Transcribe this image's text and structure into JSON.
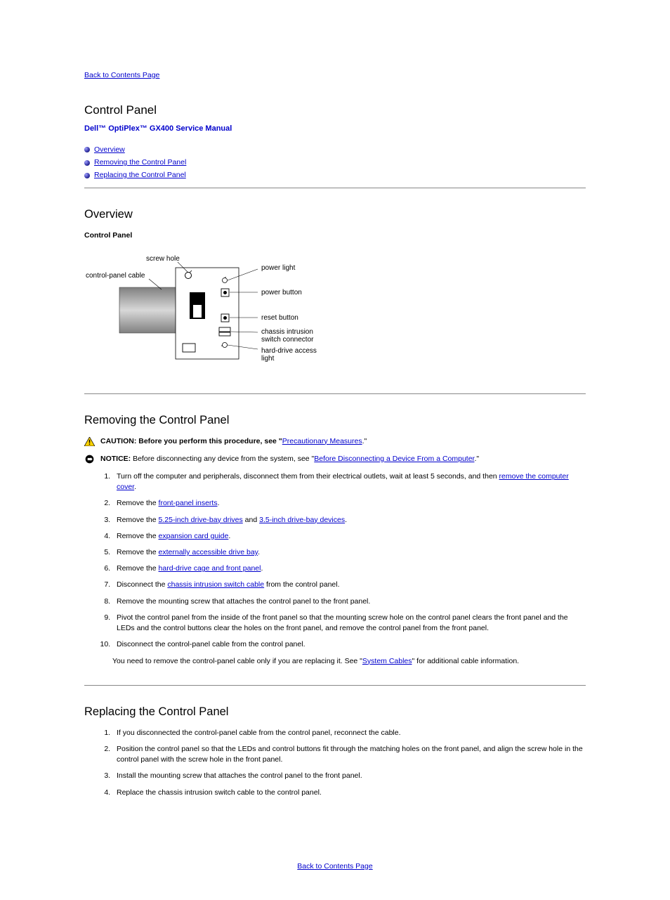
{
  "nav": {
    "back": "Back to Contents Page"
  },
  "title": {
    "main": "Control Panel",
    "manual": "Dell™ OptiPlex™ GX400 Service Manual"
  },
  "toc": {
    "overview": "Overview",
    "remove": "Removing the Control Panel",
    "replace": "Replacing the Control Panel"
  },
  "overview": {
    "heading": "Overview",
    "sub": "Control Panel",
    "labels": {
      "screw_hole": "screw hole",
      "cable": "control-panel cable",
      "power_light": "power light",
      "power_button": "power button",
      "reset_button": "reset button",
      "chassis_switch": "chassis intrusion switch connector",
      "hdd_light": "hard-drive access light"
    }
  },
  "remove": {
    "heading": "Removing the Control Panel",
    "caution": {
      "label": "CAUTION: Before you perform this procedure, see \"",
      "link": "Precautionary Measures",
      "tail": ".\""
    },
    "notice": {
      "label": "NOTICE:",
      "pre": " Before disconnecting any device from the system, see \"",
      "link": "Before Disconnecting a Device From a Computer",
      "tail": ".\""
    },
    "steps": {
      "s1_a": "Turn off the computer and peripherals, disconnect them from their electrical outlets, wait at least 5 seconds, and then ",
      "s1_link": "remove the computer cover",
      "s1_b": ".",
      "s2_a": "Remove the ",
      "s2_link": "front-panel inserts",
      "s2_b": ".",
      "s3_a": "Remove the ",
      "s3_link1": "5.25-inch drive-bay drives",
      "s3_mid": " and ",
      "s3_link2": "3.5-inch drive-bay devices",
      "s3_b": ".",
      "s4_a": "Remove the ",
      "s4_link": "expansion card guide",
      "s4_b": ".",
      "s5_a": "Remove the ",
      "s5_link": "externally accessible drive bay",
      "s5_b": ".",
      "s6_a": "Remove the ",
      "s6_link": "hard-drive cage and front panel",
      "s6_b": ".",
      "s7_a": "Disconnect the ",
      "s7_link": "chassis intrusion switch cable",
      "s7_b": " from the control panel.",
      "s8": "Remove the mounting screw that attaches the control panel to the front panel.",
      "s9": "Pivot the control panel from the inside of the front panel so that the mounting screw hole on the control panel clears the front panel and the LEDs and the control buttons clear the holes on the front panel, and remove the control panel from the front panel.",
      "s10": "Disconnect the control-panel cable from the control panel.",
      "note_a": "You need to remove the control-panel cable only if you are replacing it. See \"",
      "note_link": "System Cables",
      "note_b": "\" for additional cable information."
    }
  },
  "replace": {
    "heading": "Replacing the Control Panel",
    "steps": {
      "s1": "If you disconnected the control-panel cable from the control panel, reconnect the cable.",
      "s2": "Position the control panel so that the LEDs and control buttons fit through the matching holes on the front panel, and align the screw hole in the control panel with the screw hole in the front panel.",
      "s3": "Install the mounting screw that attaches the control panel to the front panel.",
      "s4": "Replace the chassis intrusion switch cable to the control panel."
    }
  },
  "footer": {
    "back": "Back to Contents Page"
  }
}
